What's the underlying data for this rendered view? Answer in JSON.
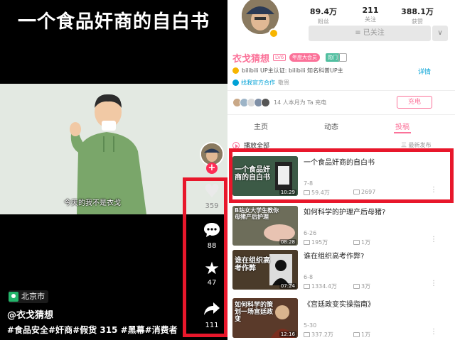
{
  "player": {
    "video_title": "一个食品奸商的自白书",
    "subtitle": "今天的我不是衣戈",
    "follow_plus": "+",
    "actions": {
      "like_count": "359",
      "comment_count": "88",
      "star_count": "47",
      "share_count": "111"
    },
    "location": "北京市",
    "author": "@衣戈猜想",
    "hashtags": "#食品安全#奸商#假货 315 #黑幕#消费者"
  },
  "profile": {
    "stats": [
      {
        "value": "89.4万",
        "label": "粉丝"
      },
      {
        "value": "211",
        "label": "关注"
      },
      {
        "value": "388.1万",
        "label": "获赞"
      }
    ],
    "followed_label": "≡ 已关注",
    "more_label": "∨",
    "name": "衣戈猜想",
    "level": "LV6",
    "vip_badge": "年度大会员",
    "medal": "勋门",
    "certification": "bilibili UP主认证: bilibili 知名科普UP主",
    "detail_link": "详情",
    "official_link": "找我官方合作",
    "official_sub": "敬畏",
    "charge_text": "14 人本月为 Ta 充电",
    "charge_button": "充电",
    "tabs": [
      {
        "label": "主页"
      },
      {
        "label": "动态"
      },
      {
        "label": "投稿"
      }
    ],
    "play_all": "播放全部",
    "sort_label": "三 最新发布",
    "videos": [
      {
        "title": "一个食品奸商的自白书",
        "date": "7-8",
        "plays": "59.4万",
        "comments": "2697",
        "duration": "10:29",
        "caption": "一个食品奸商的自白书",
        "thumb_color": "#3c5a46"
      },
      {
        "title": "如何科学的护理产后母猪?",
        "date": "6-26",
        "plays": "195万",
        "comments": "1万",
        "duration": "08:28",
        "caption": "B站女大学生教你母猪产后护理",
        "thumb_color": "#6d6d5a"
      },
      {
        "title": "谁在组织高考作弊?",
        "date": "6-8",
        "plays": "1334.4万",
        "comments": "3万",
        "duration": "07:24",
        "caption": "谁在组织高考作弊",
        "thumb_color": "#4a3b2a"
      },
      {
        "title": "《宫廷政变实操指南》",
        "date": "5-30",
        "plays": "337.2万",
        "comments": "1万",
        "duration": "12:16",
        "caption": "如何科学的策划一场宫廷政变",
        "thumb_color": "#5a3a2a"
      }
    ]
  },
  "colors": {
    "brand_pink": "#fb7299",
    "highlight_red": "#e8172b",
    "link_blue": "#00a1d6"
  },
  "icons": [
    "heart-icon",
    "comment-icon",
    "star-icon",
    "share-icon",
    "location-pin-icon",
    "play-all-icon",
    "more-dots-icon"
  ]
}
